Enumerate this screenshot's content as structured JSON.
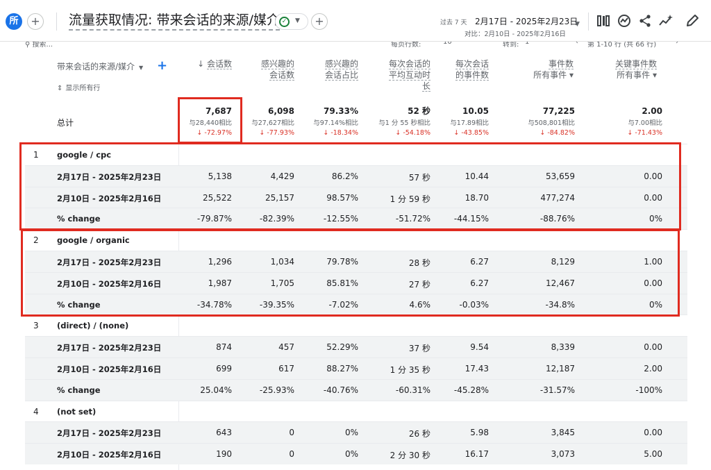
{
  "header": {
    "avatar_char": "所",
    "title": "流量获取情况: 带来会话的来源/媒介",
    "date_range_label": "过去 7 天",
    "date_range": "2月17日 - 2025年2月23日",
    "compare_range": "对比：2月10日 - 2025年2月16日"
  },
  "toolbar_ghost": {
    "search": "搜索...",
    "rows_per_page": "每页行数:",
    "rows_value": "10",
    "goto": "转到:",
    "goto_value": "1",
    "pagination": "第 1-10 行 (共 66 行)"
  },
  "table": {
    "dimension_header": "带来会话的来源/媒介",
    "show_all_rows": "显示所有行",
    "total_label": "总计",
    "columns": [
      {
        "line1": "会话数",
        "line2": "",
        "line3": "",
        "sort": "↓"
      },
      {
        "line1": "感兴趣的",
        "line2": "会话数",
        "line3": ""
      },
      {
        "line1": "感兴趣的",
        "line2": "会话占比",
        "line3": ""
      },
      {
        "line1": "每次会话的",
        "line2": "平均互动时",
        "line3": "长"
      },
      {
        "line1": "每次会话",
        "line2": "的事件数",
        "line3": ""
      },
      {
        "line1": "事件数",
        "line2": "所有事件 ▾",
        "line3": ""
      },
      {
        "line1": "关键事件数",
        "line2": "所有事件 ▾",
        "line3": ""
      }
    ],
    "totals": [
      {
        "value": "7,687",
        "compare": "与28,440相比",
        "delta": "↓ -72.97%"
      },
      {
        "value": "6,098",
        "compare": "与27,627相比",
        "delta": "↓ -77.93%"
      },
      {
        "value": "79.33%",
        "compare": "与97.14%相比",
        "delta": "↓ -18.34%"
      },
      {
        "value": "52 秒",
        "compare": "与1 分 55 秒相比",
        "delta": "↓ -54.18%"
      },
      {
        "value": "10.05",
        "compare": "与17.89相比",
        "delta": "↓ -43.85%"
      },
      {
        "value": "77,225",
        "compare": "与508,801相比",
        "delta": "↓ -84.82%"
      },
      {
        "value": "2.00",
        "compare": "与7.00相比",
        "delta": "↓ -71.43%"
      }
    ],
    "groups": [
      {
        "index": "1",
        "name": "google / cpc",
        "rows": [
          {
            "label": "2月17日 - 2025年2月23日",
            "values": [
              "5,138",
              "4,429",
              "86.2%",
              "57 秒",
              "10.44",
              "53,659",
              "0.00"
            ]
          },
          {
            "label": "2月10日 - 2025年2月16日",
            "values": [
              "25,522",
              "25,157",
              "98.57%",
              "1 分 59 秒",
              "18.70",
              "477,274",
              "0.00"
            ]
          },
          {
            "label": "% change",
            "values": [
              "-79.87%",
              "-82.39%",
              "-12.55%",
              "-51.72%",
              "-44.15%",
              "-88.76%",
              "0%"
            ]
          }
        ]
      },
      {
        "index": "2",
        "name": "google / organic",
        "rows": [
          {
            "label": "2月17日 - 2025年2月23日",
            "values": [
              "1,296",
              "1,034",
              "79.78%",
              "28 秒",
              "6.27",
              "8,129",
              "1.00"
            ]
          },
          {
            "label": "2月10日 - 2025年2月16日",
            "values": [
              "1,987",
              "1,705",
              "85.81%",
              "27 秒",
              "6.27",
              "12,467",
              "0.00"
            ]
          },
          {
            "label": "% change",
            "values": [
              "-34.78%",
              "-39.35%",
              "-7.02%",
              "4.6%",
              "-0.03%",
              "-34.8%",
              "0%"
            ]
          }
        ]
      },
      {
        "index": "3",
        "name": "(direct) / (none)",
        "rows": [
          {
            "label": "2月17日 - 2025年2月23日",
            "values": [
              "874",
              "457",
              "52.29%",
              "37 秒",
              "9.54",
              "8,339",
              "0.00"
            ]
          },
          {
            "label": "2月10日 - 2025年2月16日",
            "values": [
              "699",
              "617",
              "88.27%",
              "1 分 35 秒",
              "17.43",
              "12,187",
              "2.00"
            ]
          },
          {
            "label": "% change",
            "values": [
              "25.04%",
              "-25.93%",
              "-40.76%",
              "-60.31%",
              "-45.28%",
              "-31.57%",
              "-100%"
            ]
          }
        ]
      },
      {
        "index": "4",
        "name": "(not set)",
        "rows": [
          {
            "label": "2月17日 - 2025年2月23日",
            "values": [
              "643",
              "0",
              "0%",
              "26 秒",
              "5.98",
              "3,845",
              "0.00"
            ]
          },
          {
            "label": "2月10日 - 2025年2月16日",
            "values": [
              "190",
              "0",
              "0%",
              "2 分 30 秒",
              "16.17",
              "3,073",
              "5.00"
            ]
          }
        ]
      }
    ]
  },
  "colors": {
    "accent": "#1a73e8",
    "highlight": "#e02b20",
    "negative": "#d93025",
    "ok": "#188038"
  }
}
